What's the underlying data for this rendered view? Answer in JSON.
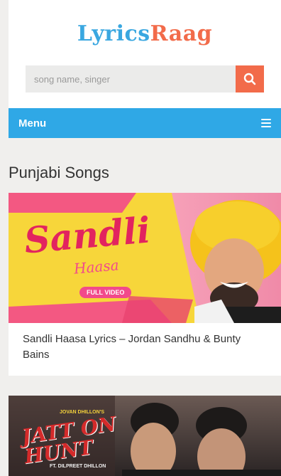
{
  "logo": {
    "part1": "Lyrics",
    "part2": "Raag"
  },
  "search": {
    "placeholder": "song name, singer",
    "button_icon": "search-icon"
  },
  "menu": {
    "label": "Menu",
    "icon": "hamburger-icon"
  },
  "section": {
    "title": "Punjabi Songs"
  },
  "posts": [
    {
      "title": "Sandli Haasa Lyrics – Jordan Sandhu & Bunty Bains",
      "thumb_text": "Sandli",
      "thumb_subtext": "Haasa",
      "thumb_badge": "FULL VIDEO"
    },
    {
      "title": "",
      "thumb_text_top": "JOVAN DHILLON'S",
      "thumb_text": "JATT ON HUNT",
      "thumb_badge": "FT. DILPREET DHILLON"
    }
  ],
  "colors": {
    "accent_blue": "#2fa8e6",
    "accent_orange": "#f26b4a",
    "thumb1_pink": "#f24a8b",
    "thumb1_yellow": "#f7d63a"
  }
}
